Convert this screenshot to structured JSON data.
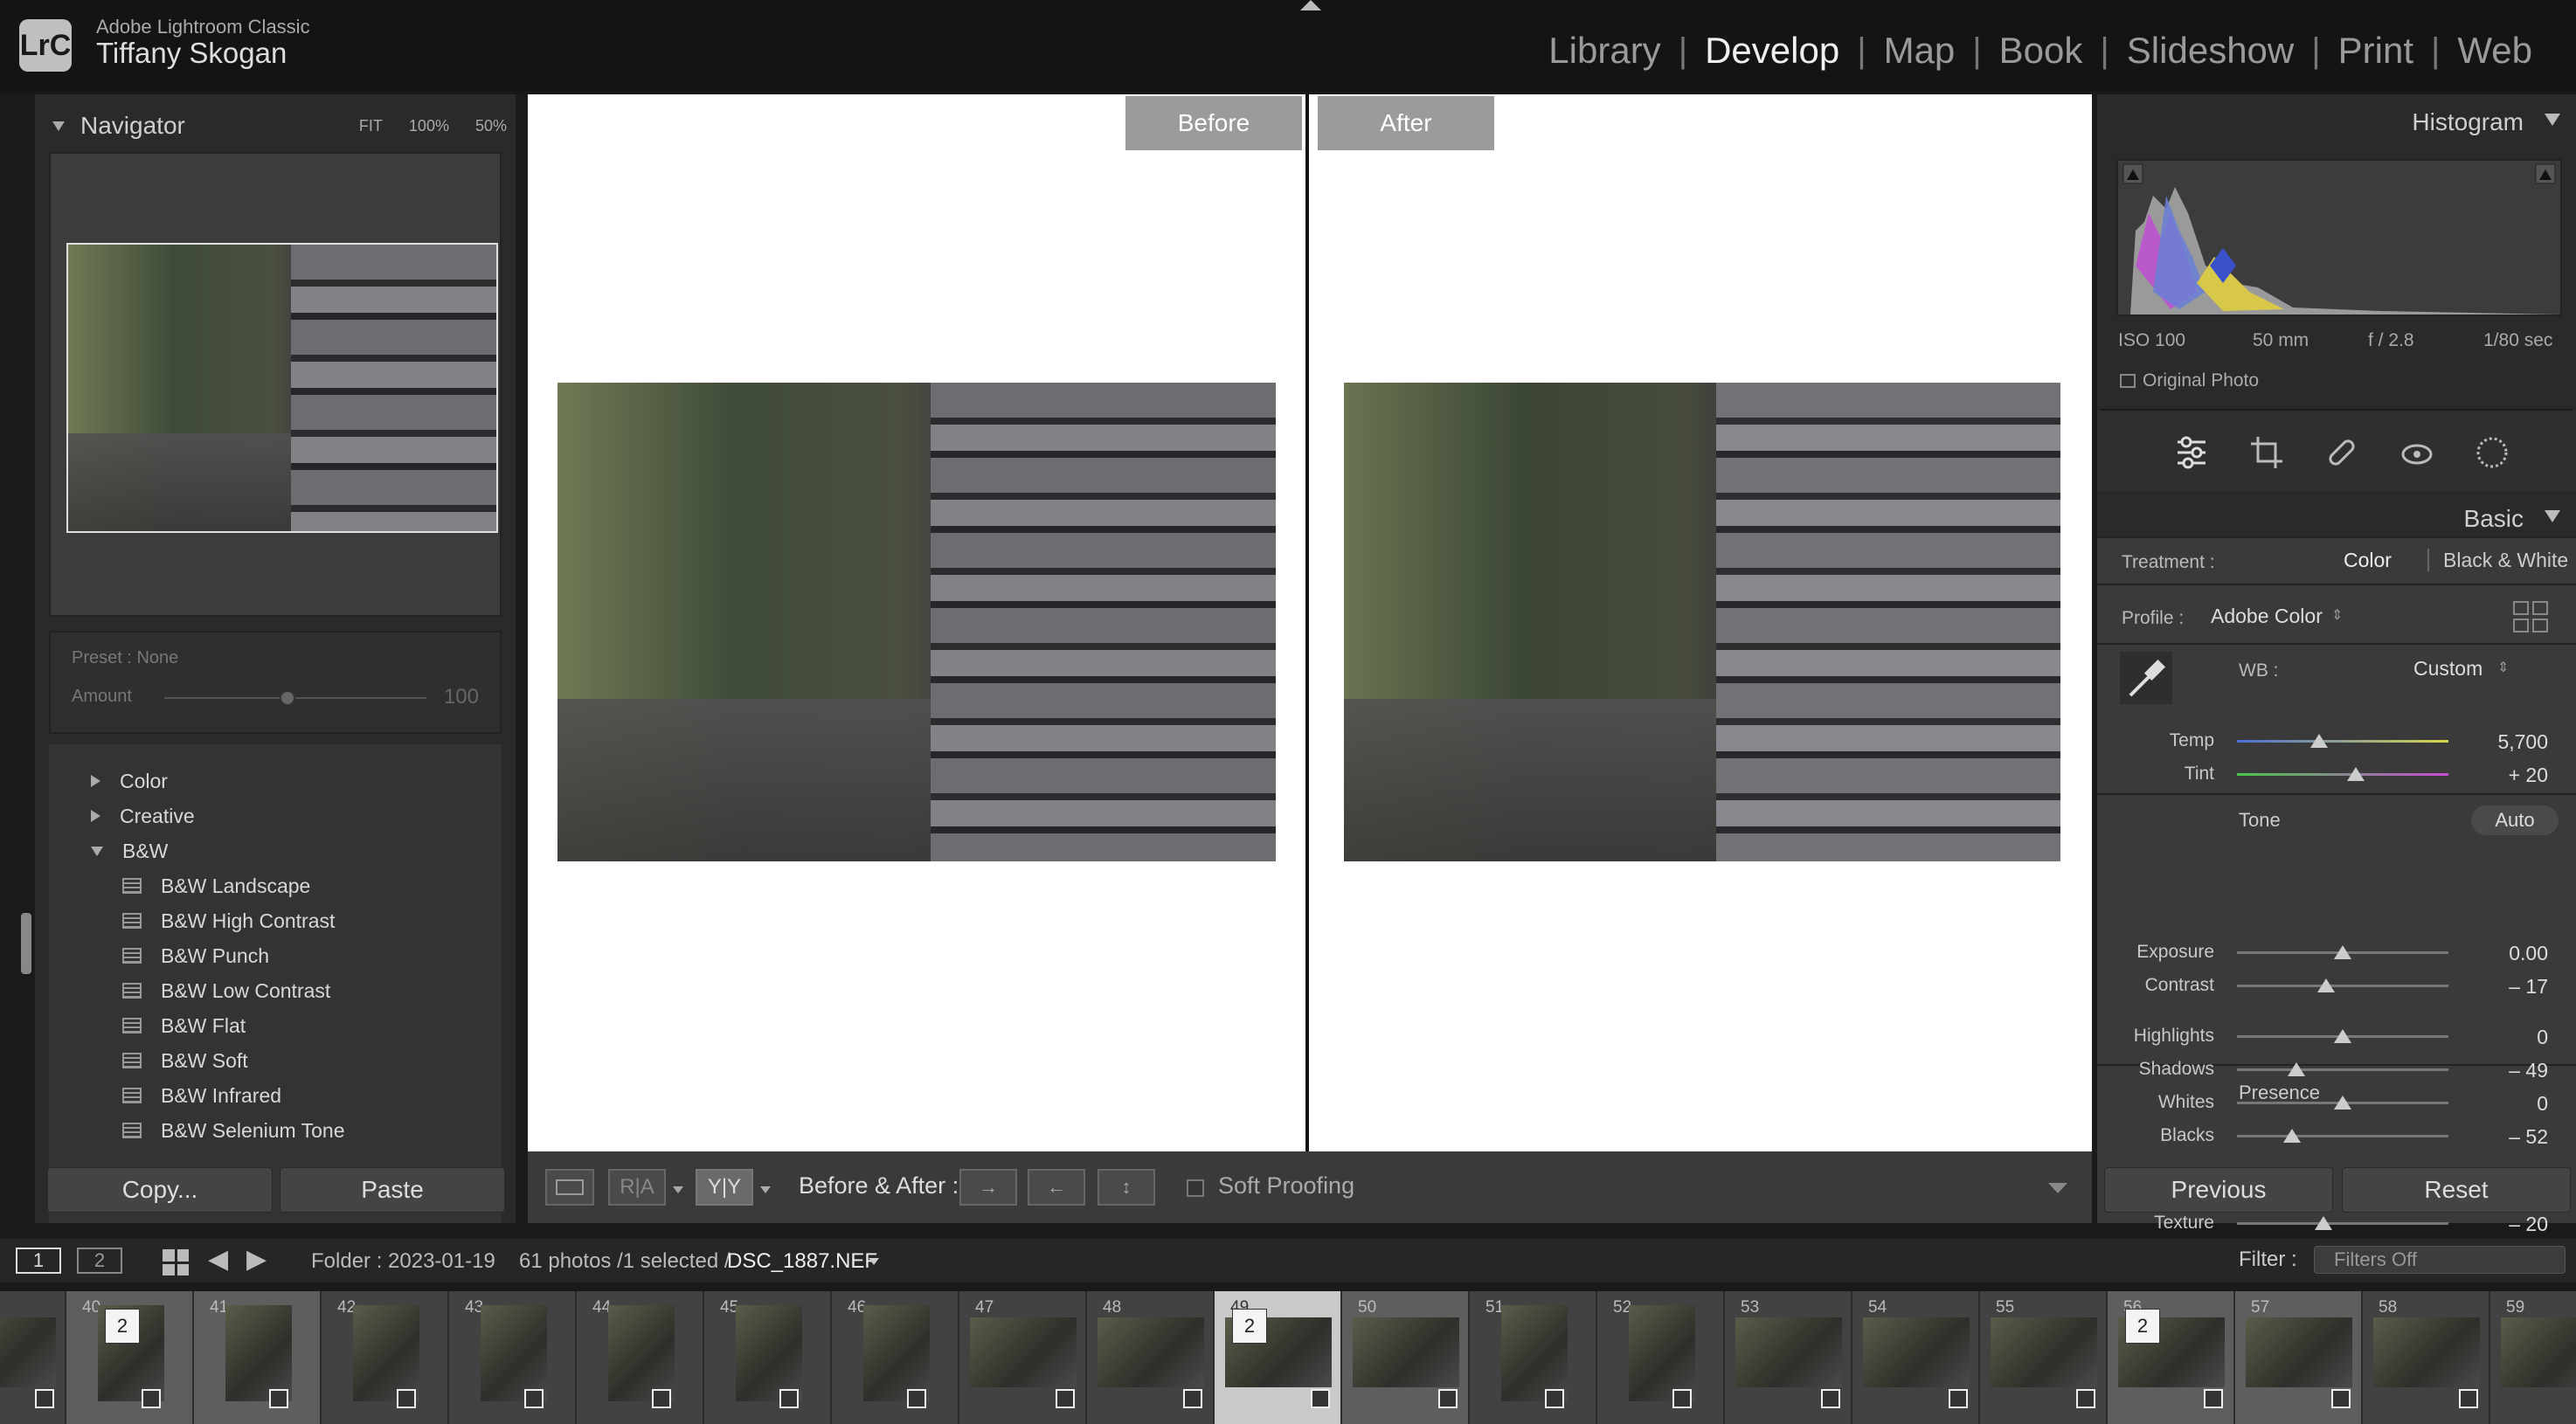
{
  "app": {
    "product": "Adobe Lightroom Classic",
    "user": "Tiffany Skogan",
    "logo_text": "LrC"
  },
  "modules": [
    "Library",
    "Develop",
    "Map",
    "Book",
    "Slideshow",
    "Print",
    "Web"
  ],
  "active_module": "Develop",
  "navigator": {
    "title": "Navigator",
    "zoom_options": [
      "FIT",
      "100%",
      "50%"
    ]
  },
  "preset": {
    "label": "Preset : None",
    "amount_label": "Amount",
    "amount_value": "100"
  },
  "presets": {
    "groups": [
      {
        "name": "Color",
        "expanded": false
      },
      {
        "name": "Creative",
        "expanded": false
      },
      {
        "name": "B&W",
        "expanded": true
      }
    ],
    "items": [
      "B&W Landscape",
      "B&W High Contrast",
      "B&W Punch",
      "B&W Low Contrast",
      "B&W Flat",
      "B&W Soft",
      "B&W Infrared",
      "B&W Selenium Tone"
    ]
  },
  "left_buttons": {
    "copy": "Copy...",
    "paste": "Paste"
  },
  "view": {
    "before_label": "Before",
    "after_label": "After"
  },
  "toolbar": {
    "ba_label": "Before & After :",
    "soft_proofing": "Soft Proofing",
    "view_ra": "R|A",
    "view_yy": "Y|Y"
  },
  "histogram": {
    "title": "Histogram",
    "iso": "ISO 100",
    "focal": "50 mm",
    "aperture": "f / 2.8",
    "shutter": "1/80 sec",
    "original_photo": "Original Photo"
  },
  "basic": {
    "title": "Basic",
    "treatment_label": "Treatment :",
    "treatment_color": "Color",
    "treatment_bw": "Black & White",
    "profile_label": "Profile :",
    "profile_value": "Adobe Color",
    "wb_label": "WB :",
    "wb_value": "Custom",
    "tone_label": "Tone",
    "auto_label": "Auto",
    "presence_label": "Presence",
    "sliders": [
      {
        "label": "Temp",
        "value": "5,700",
        "position": 0.39
      },
      {
        "label": "Tint",
        "value": "+ 20",
        "position": 0.56
      },
      {
        "label": "Exposure",
        "value": "0.00",
        "position": 0.5
      },
      {
        "label": "Contrast",
        "value": "– 17",
        "position": 0.42
      },
      {
        "label": "Highlights",
        "value": "0",
        "position": 0.5
      },
      {
        "label": "Shadows",
        "value": "– 49",
        "position": 0.28
      },
      {
        "label": "Whites",
        "value": "0",
        "position": 0.5
      },
      {
        "label": "Blacks",
        "value": "– 52",
        "position": 0.26
      },
      {
        "label": "Texture",
        "value": "– 20",
        "position": 0.41
      }
    ]
  },
  "right_buttons": {
    "previous": "Previous",
    "reset": "Reset"
  },
  "status": {
    "page1": "1",
    "page2": "2",
    "folder": "Folder : 2023-01-19",
    "count": "61 photos /1 selected /",
    "filename": "DSC_1887.NEF",
    "filter_label": "Filter :",
    "filter_value": "Filters Off"
  },
  "filmstrip": [
    {
      "num": "",
      "stack": ""
    },
    {
      "num": "40",
      "stack": "2"
    },
    {
      "num": "41",
      "stack": ""
    },
    {
      "num": "42",
      "stack": ""
    },
    {
      "num": "43",
      "stack": ""
    },
    {
      "num": "44",
      "stack": ""
    },
    {
      "num": "45",
      "stack": ""
    },
    {
      "num": "46",
      "stack": ""
    },
    {
      "num": "47",
      "stack": ""
    },
    {
      "num": "48",
      "stack": ""
    },
    {
      "num": "49",
      "stack": "2"
    },
    {
      "num": "50",
      "stack": ""
    },
    {
      "num": "51",
      "stack": ""
    },
    {
      "num": "52",
      "stack": ""
    },
    {
      "num": "53",
      "stack": ""
    },
    {
      "num": "54",
      "stack": ""
    },
    {
      "num": "55",
      "stack": ""
    },
    {
      "num": "56",
      "stack": "2"
    },
    {
      "num": "57",
      "stack": ""
    },
    {
      "num": "58",
      "stack": ""
    },
    {
      "num": "59",
      "stack": ""
    }
  ],
  "colors": {
    "accent_blue": "#4a6fd6",
    "panel_bg": "#2a2a2a",
    "selected_cell": "#c9c9c9"
  }
}
